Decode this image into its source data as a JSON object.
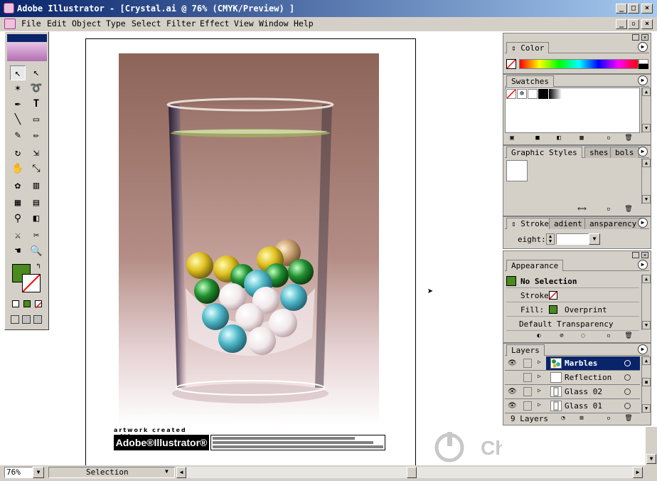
{
  "window": {
    "title": "Adobe Illustrator - [Crystal.ai @ 76% (CMYK/Preview) ]"
  },
  "menu": [
    "File",
    "Edit",
    "Object",
    "Type",
    "Select",
    "Filter",
    "Effect",
    "View",
    "Window",
    "Help"
  ],
  "artwork": {
    "copyright": "Copyright © 2001 by MiyamotoYukio  Japan",
    "email": "yukio-m@ppp.bekkoame.ne.jp",
    "created_with": "artwork created with",
    "brand": "Adobe®Illustrator®"
  },
  "color_panel": {
    "tab": "Color"
  },
  "swatches_panel": {
    "tab": "Swatches"
  },
  "styles_panel": {
    "tabs": [
      "Graphic Styles",
      "shes",
      "bols"
    ]
  },
  "stroke_panel": {
    "tabs": [
      "Stroke",
      "adient",
      "ansparency"
    ],
    "weight_label": "eight:"
  },
  "appearance_panel": {
    "tab": "Appearance",
    "selection": "No Selection",
    "stroke_label": "Stroke:",
    "fill_label": "Fill:",
    "overprint": "Overprint",
    "transparency": "Default Transparency"
  },
  "layers_panel": {
    "tab": "Layers",
    "layers": [
      "Marbles",
      "Reflection",
      "Glass 02",
      "Glass 01"
    ],
    "count": "9 Layers"
  },
  "status": {
    "zoom": "76%",
    "tool": "Selection"
  },
  "watermark": "ChinaUI.com",
  "colors": {
    "titlebar_start": "#08246b",
    "titlebar_end": "#a6caf0",
    "selected_layer": "#0a246a",
    "fill_green": "#4a8a20"
  }
}
